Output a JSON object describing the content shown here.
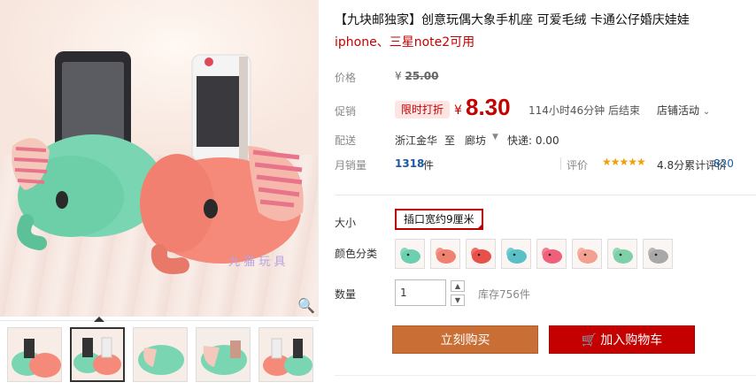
{
  "product": {
    "title": "【九块邮独家】创意玩偶大象手机座 可爱毛绒 卡通公仔婚庆娃娃",
    "subtitle": "iphone、三星note2可用"
  },
  "gallery": {
    "watermark": "九 猫 玩 具",
    "thumbnails": [
      {
        "name": "thumb-1"
      },
      {
        "name": "thumb-2"
      },
      {
        "name": "thumb-3"
      },
      {
        "name": "thumb-4"
      },
      {
        "name": "thumb-5"
      }
    ],
    "active_thumbnail": 2
  },
  "labels": {
    "price": "价格",
    "promo": "促销",
    "shipping": "配送",
    "monthly_sales": "月销量",
    "size": "大小",
    "color": "颜色分类",
    "quantity": "数量",
    "rating": "评价"
  },
  "price": {
    "original_currency": "¥",
    "original": "25.00",
    "promo_badge": "限时打折",
    "currency": "¥",
    "current": "8.30",
    "countdown": "114小时46分钟 后结束",
    "shop_activity": "店铺活动"
  },
  "shipping": {
    "from": "浙江金华",
    "to_word": "至",
    "destination": "廊坊",
    "fee": "快递: 0.00"
  },
  "sales": {
    "count": "1318",
    "unit": "件",
    "stars": "★★★★★",
    "score": "4.8分",
    "review_prefix": "累计评价",
    "review_count": "820"
  },
  "options": {
    "size_selected": "插口宽约9厘米",
    "colors": [
      "#6bcfb0",
      "#f08070",
      "#e8504a",
      "#5ac0c8",
      "#f0607a",
      "#f4a090",
      "#7ed0a8",
      "#a8a8a8"
    ]
  },
  "quantity": {
    "value": "1",
    "up": "▲",
    "down": "▼",
    "stock": "库存756件"
  },
  "actions": {
    "buy_now": "立刻购买",
    "add_to_cart": "加入购物车"
  },
  "icons": {
    "zoom": "magnifier-icon",
    "cart": "cart-icon"
  }
}
